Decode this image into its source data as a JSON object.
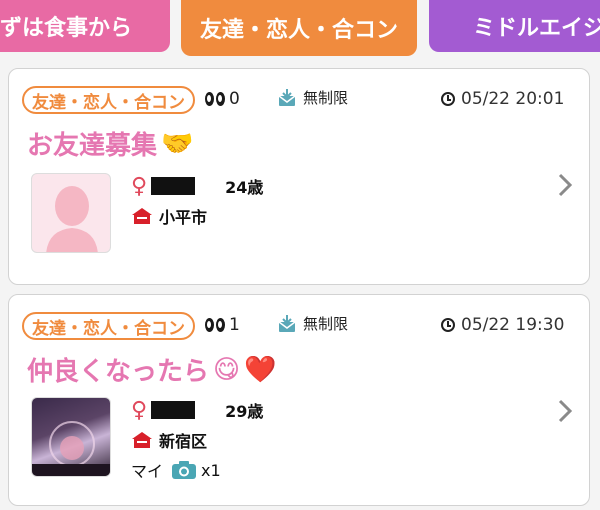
{
  "tabs": [
    {
      "label": "ずは食事から"
    },
    {
      "label": "友達・恋人・合コン"
    },
    {
      "label": "ミドルエイジ"
    }
  ],
  "colors": {
    "orange": "#f08b3e",
    "pink": "#e86aa4",
    "purple": "#a35bd2",
    "title": "#e577b1"
  },
  "posts": [
    {
      "category": "友達・恋人・合コン",
      "views": "0",
      "mail_limit": "無制限",
      "datetime": "05/22 20:01",
      "title": "お友達募集",
      "title_emoji": [
        "🤝"
      ],
      "age": "24歳",
      "location": "小平市",
      "avatar": "placeholder-silhouette"
    },
    {
      "category": "友達・恋人・合コン",
      "views": "1",
      "mail_limit": "無制限",
      "datetime": "05/22 19:30",
      "title": "仲良くなったら",
      "title_emoji": [
        "😋",
        "❤️"
      ],
      "age": "29歳",
      "location": "新宿区",
      "name": "マイ",
      "photo_count": "x1",
      "avatar": "photo"
    }
  ],
  "icons": [
    "eyes-icon",
    "mail-icon",
    "clock-icon",
    "female-icon",
    "house-icon",
    "camera-icon",
    "chevron-right-icon"
  ]
}
